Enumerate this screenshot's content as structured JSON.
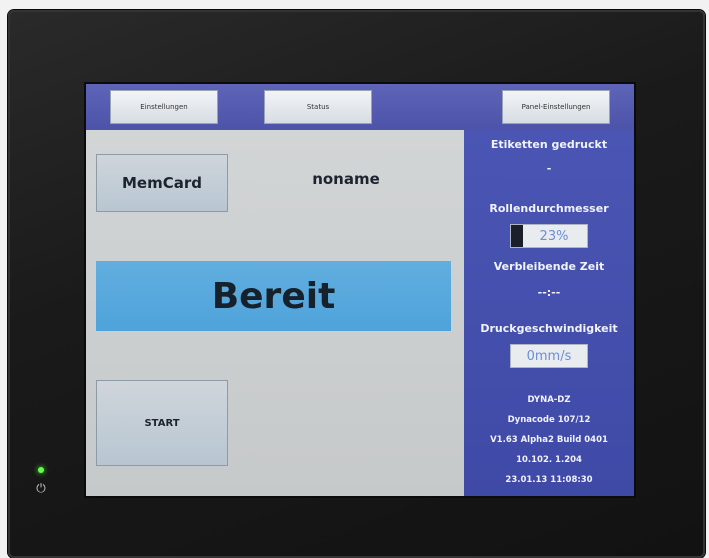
{
  "topbar": {
    "buttons": [
      {
        "label": "Einstellungen"
      },
      {
        "label": "Status"
      },
      {
        "label": "Panel-Einstellungen"
      }
    ]
  },
  "left": {
    "memcard_label": "MemCard",
    "job_name": "noname",
    "state": "Bereit",
    "start_label": "START"
  },
  "right": {
    "printed_label": "Etiketten gedruckt",
    "printed_value": "-",
    "roll_label": "Rollendurchmesser",
    "roll_percent": "23%",
    "roll_fraction": 0.23,
    "remaining_label": "Verbleibende Zeit",
    "remaining_value": "--:--",
    "speed_label": "Druckgeschwindigkeit",
    "speed_value": "0mm/s",
    "device_name": "DYNA-DZ",
    "model": "Dynacode 107/12",
    "version": "V1.63 Alpha2 Build 0401",
    "ip": "10.102.  1.204",
    "datetime": "23.01.13 11:08:30"
  },
  "colors": {
    "topbar": "#5e64b8",
    "sidebar": "#4b56b4",
    "status_banner": "#56a8dd",
    "screen_bg": "#c9cccc",
    "led": "#63ff4a"
  },
  "icons": {
    "status_led": "status-led-icon",
    "power": "power-icon"
  }
}
